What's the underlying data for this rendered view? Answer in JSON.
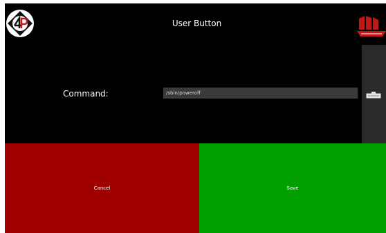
{
  "header": {
    "title": "User Button"
  },
  "form": {
    "command_label": "Command:",
    "command_value": "/sbin/poweroff"
  },
  "buttons": {
    "cancel_label": "Cancel",
    "save_label": "Save"
  },
  "icons": {
    "left_logo": "4p-logo-icon",
    "right_logo": "red-ship-logo-icon",
    "keypad": "keyboard-icon"
  },
  "colors": {
    "background": "#000000",
    "cancel": "#a00000",
    "save": "#00a000",
    "input": "#3a3a3a",
    "brand_red": "#c01818"
  }
}
